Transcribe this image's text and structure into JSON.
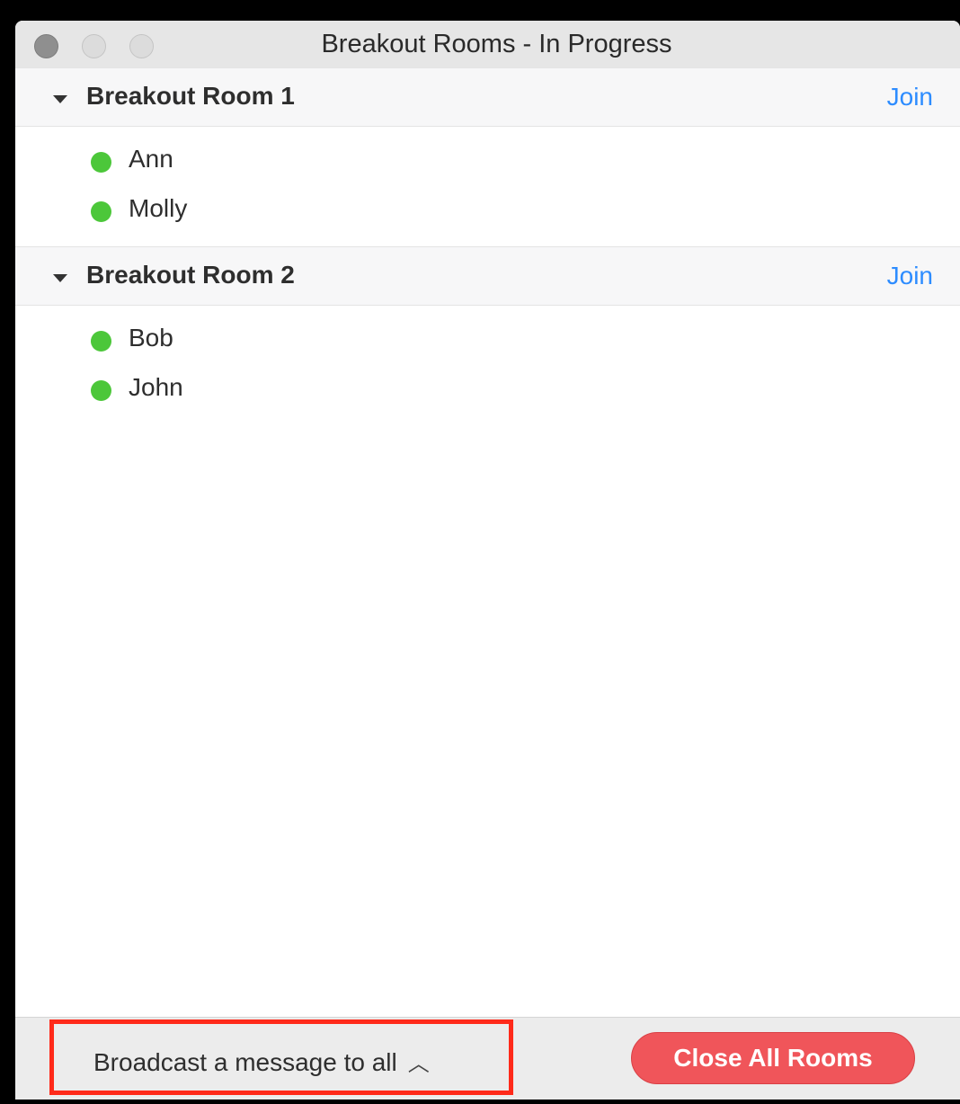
{
  "window": {
    "title": "Breakout Rooms - In Progress"
  },
  "rooms": [
    {
      "name": "Breakout Room 1",
      "join_label": "Join",
      "participants": [
        "Ann",
        "Molly"
      ]
    },
    {
      "name": "Breakout Room 2",
      "join_label": "Join",
      "participants": [
        "Bob",
        "John"
      ]
    }
  ],
  "footer": {
    "broadcast_label": "Broadcast a message to all",
    "broadcast_chevron_icon": "chevron-up-icon",
    "close_all_label": "Close All Rooms"
  },
  "colors": {
    "join_link": "#2d8cff",
    "status_online": "#4cc73a",
    "close_button": "#f0555a",
    "highlight_box": "#ff2a1a"
  }
}
